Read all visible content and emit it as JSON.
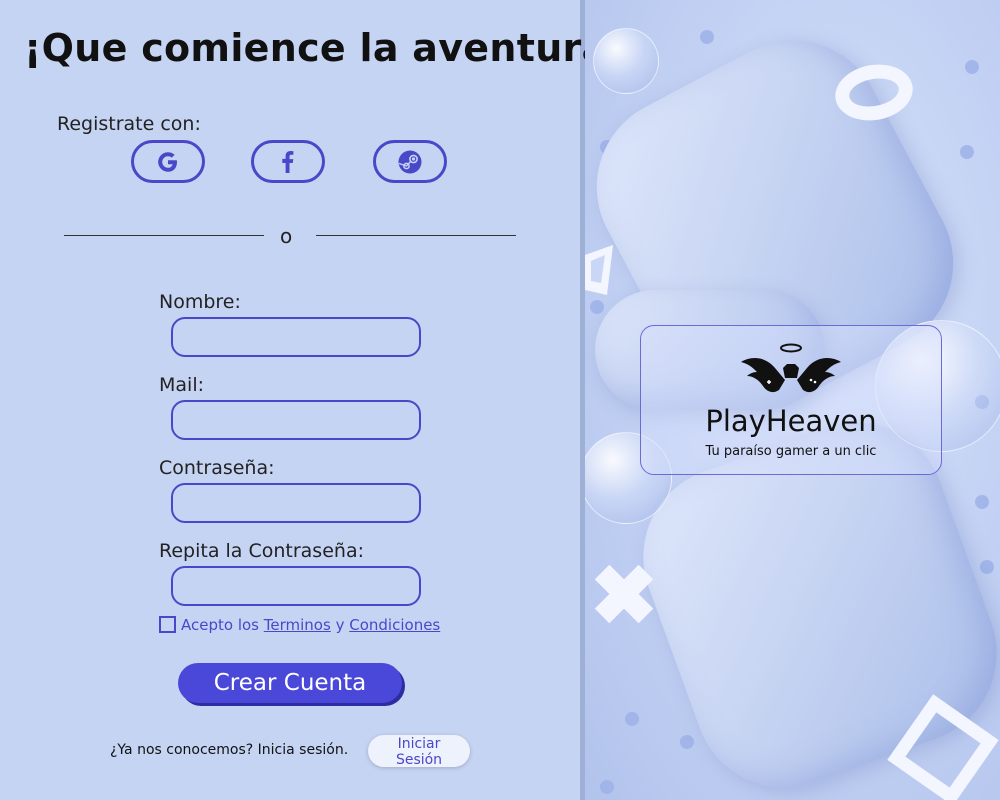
{
  "form": {
    "title": "¡Que comience la aventura!",
    "register_with": "Registrate con:",
    "social": [
      {
        "name": "Google",
        "icon": "google-icon"
      },
      {
        "name": "Facebook",
        "icon": "facebook-icon"
      },
      {
        "name": "Steam",
        "icon": "steam-icon"
      }
    ],
    "or": "o",
    "fields": [
      {
        "label": "Nombre:",
        "value": "",
        "placeholder": ""
      },
      {
        "label": "Mail:",
        "value": "",
        "placeholder": ""
      },
      {
        "label": "Contraseña:",
        "value": "",
        "placeholder": ""
      },
      {
        "label": "Repita la Contraseña:",
        "value": "",
        "placeholder": ""
      }
    ],
    "terms": {
      "prefix": "Acepto los",
      "terms_link": "Terminos",
      "and": "y",
      "conditions_link": "Condiciones",
      "checked": false
    },
    "create_button": "Crear Cuenta",
    "login_question": "¿Ya nos conocemos? Inicia sesión.",
    "login_button": "Iniciar Sesión"
  },
  "brand": {
    "name": "PlayHeaven",
    "tagline": "Tu paraíso gamer a un clic"
  },
  "colors": {
    "accent": "#4a48d8",
    "background": "#c6d4f4",
    "text": "#111111"
  }
}
